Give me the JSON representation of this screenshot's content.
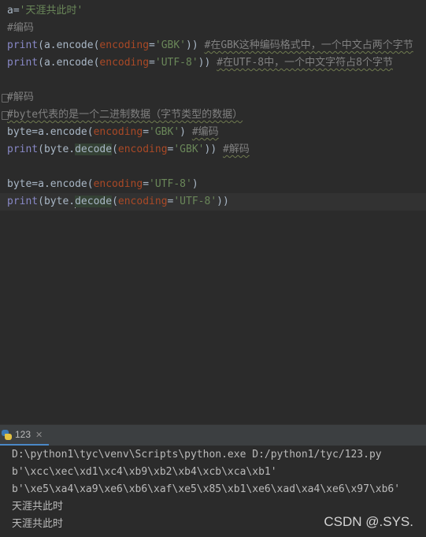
{
  "editor": {
    "line1": {
      "var": "a=",
      "str": "'天涯共此时'"
    },
    "line2": {
      "comment": "#编码"
    },
    "line3": {
      "print": "print",
      "p1": "(a.encode(",
      "kw": "encoding",
      "eq": "=",
      "str": "'GBK'",
      "close": "))",
      "comment": "#在GBK这种编码格式中，一个中文占两个字节"
    },
    "line4": {
      "print": "print",
      "p1": "(a.encode(",
      "kw": "encoding",
      "eq": "=",
      "str": "'UTF-8'",
      "close": "))",
      "comment": "#在UTF-8中，一个中文字符占8个字节"
    },
    "line6": {
      "comment": "#解码"
    },
    "line7": {
      "comment": "#byte代表的是一个二进制数据（字节类型的数据）"
    },
    "line8": {
      "p1": "byte=a.encode(",
      "kw": "encoding",
      "eq": "=",
      "str": "'GBK'",
      "close": ")",
      "comment": "#编码"
    },
    "line9": {
      "print": "print",
      "p1": "(byte.",
      "method": "decode",
      "p2": "(",
      "kw": "encoding",
      "eq": "=",
      "str": "'GBK'",
      "close": "))",
      "comment": "#解码"
    },
    "line11": {
      "p1": "byte=a.encode(",
      "kw": "encoding",
      "eq": "=",
      "str": "'UTF-8'",
      "close": ")"
    },
    "line12": {
      "print": "print",
      "p1": "(byte.",
      "method": "decode",
      "p2": "(",
      "kw": "encoding",
      "eq": "=",
      "str": "'UTF-8'",
      "close": "))"
    }
  },
  "run_panel": {
    "tab_label": "123",
    "tab_icon": "python-icon",
    "close_glyph": "✕",
    "output": [
      "D:\\python1\\tyc\\venv\\Scripts\\python.exe D:/python1/tyc/123.py",
      "b'\\xcc\\xec\\xd1\\xc4\\xb9\\xb2\\xb4\\xcb\\xca\\xb1'",
      "b'\\xe5\\xa4\\xa9\\xe6\\xb6\\xaf\\xe5\\x85\\xb1\\xe6\\xad\\xa4\\xe6\\x97\\xb6'",
      "天涯共此时",
      "天涯共此时"
    ]
  },
  "watermark": "CSDN @.SYS."
}
